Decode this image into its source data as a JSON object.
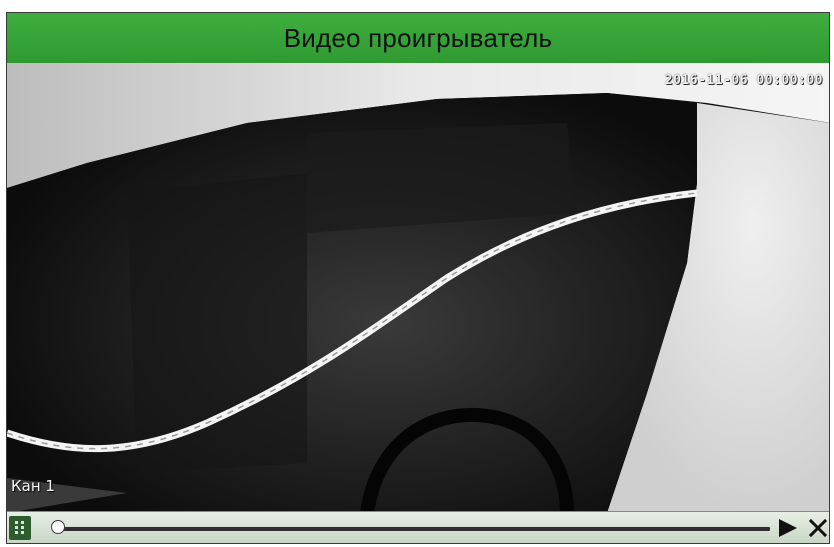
{
  "window": {
    "title": "Видео проигрыватель"
  },
  "video": {
    "timestamp": "2016-11-06 00:00:00",
    "channel_label": "Кан 1",
    "playback_progress": 0.0
  },
  "controls": {
    "play_icon": "play-icon",
    "close_icon": "close-icon",
    "grip_icon": "drag-grip-icon"
  },
  "colors": {
    "titlebar": "#35a537",
    "controls_bar": "#d6e0d3",
    "grip": "#2f5c2f",
    "track": "#2d2d2d"
  }
}
